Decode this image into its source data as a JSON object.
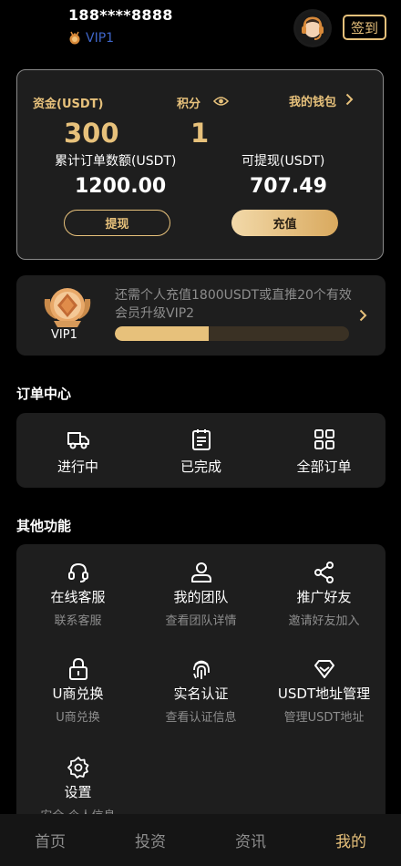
{
  "header": {
    "phone": "188****8888",
    "vip_level": "VIP1",
    "signin_label": "签到"
  },
  "assets": {
    "funds_label": "资金(USDT)",
    "funds_value": "300",
    "points_label": "积分",
    "points_value": "1",
    "wallet_label": "我的钱包",
    "cumulative_label": "累计订单数额(USDT)",
    "cumulative_value": "1200.00",
    "withdrawable_label": "可提现(USDT)",
    "withdrawable_value": "707.49",
    "withdraw_button": "提现",
    "recharge_button": "充值"
  },
  "vip_card": {
    "badge_label": "VIP1",
    "description": "还需个人充值1800USDT或直推20个有效会员升级VIP2",
    "progress_percent": 40
  },
  "order_center": {
    "title": "订单中心",
    "items": [
      {
        "label": "进行中",
        "icon": "truck-icon"
      },
      {
        "label": "已完成",
        "icon": "clipboard-icon"
      },
      {
        "label": "全部订单",
        "icon": "grid-icon"
      }
    ]
  },
  "other_functions": {
    "title": "其他功能",
    "items": [
      {
        "title": "在线客服",
        "subtitle": "联系客服",
        "icon": "headset-icon"
      },
      {
        "title": "我的团队",
        "subtitle": "查看团队详情",
        "icon": "user-icon"
      },
      {
        "title": "推广好友",
        "subtitle": "邀请好友加入",
        "icon": "share-icon"
      },
      {
        "title": "U商兑换",
        "subtitle": "U商兑换",
        "icon": "lock-icon"
      },
      {
        "title": "实名认证",
        "subtitle": "查看认证信息",
        "icon": "fingerprint-icon"
      },
      {
        "title": "USDT地址管理",
        "subtitle": "管理USDT地址",
        "icon": "diamond-icon"
      },
      {
        "title": "设置",
        "subtitle": "安全,个人信息",
        "icon": "settings-icon"
      }
    ]
  },
  "bottom_nav": {
    "items": [
      {
        "label": "首页",
        "active": false
      },
      {
        "label": "投资",
        "active": false
      },
      {
        "label": "资讯",
        "active": false
      },
      {
        "label": "我的",
        "active": true
      }
    ]
  },
  "colors": {
    "accent": "#e7c17b",
    "vip_blue": "#3f65c8",
    "card_bg": "#1e1e1e",
    "muted_text": "#8d8d8d"
  }
}
